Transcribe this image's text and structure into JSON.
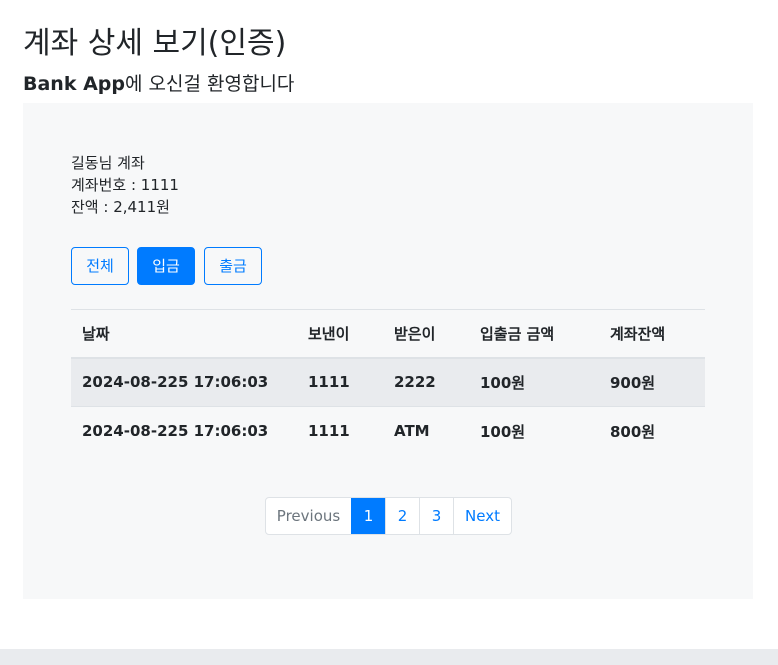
{
  "header": {
    "title": "계좌 상세 보기(인증)",
    "subtitle_brand": "Bank App",
    "subtitle_rest": "에 오신걸 환영합니다"
  },
  "account": {
    "owner_line": "길동님 계좌",
    "number_line": "계좌번호 : 1111",
    "balance_line": "잔액 : 2,411원"
  },
  "filters": {
    "all": "전체",
    "deposit": "입금",
    "withdraw": "출금",
    "active": "deposit"
  },
  "table": {
    "headers": [
      "날짜",
      "보낸이",
      "받은이",
      "입출금 금액",
      "계좌잔액"
    ],
    "rows": [
      [
        "2024-08-225 17:06:03",
        "1111",
        "2222",
        "100원",
        "900원"
      ],
      [
        "2024-08-225 17:06:03",
        "1111",
        "ATM",
        "100원",
        "800원"
      ]
    ]
  },
  "pagination": {
    "previous": "Previous",
    "pages": [
      "1",
      "2",
      "3"
    ],
    "current": "1",
    "next": "Next"
  },
  "colors": {
    "primary": "#007bff",
    "panel_bg": "#f7f8f9",
    "stripe_bg": "#e9ebee"
  }
}
